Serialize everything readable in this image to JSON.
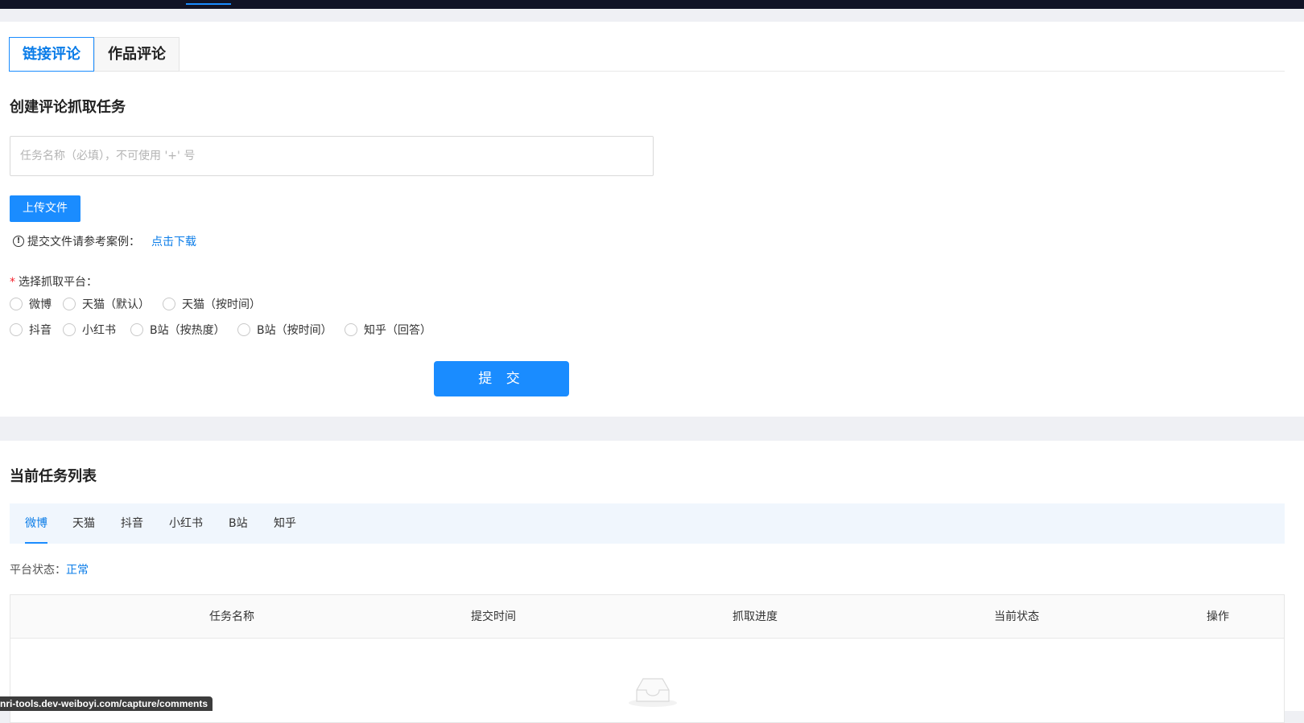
{
  "main_tabs": [
    "链接评论",
    "作品评论"
  ],
  "create": {
    "title": "创建评论抓取任务",
    "task_name_placeholder": "任务名称（必填），不可使用 '+' 号",
    "upload_label": "上传文件",
    "hint_text": "提交文件请参考案例：",
    "hint_link": "点击下载",
    "platform_label": "选择抓取平台：",
    "platform_required_mark": "*",
    "platforms_row1": [
      "微博",
      "天猫（默认）",
      "天猫（按时间）"
    ],
    "platforms_row2": [
      "抖音",
      "小红书",
      "B站（按热度）",
      "B站（按时间）",
      "知乎（回答）"
    ],
    "submit_label": "提 交"
  },
  "list": {
    "title": "当前任务列表",
    "tabs": [
      "微博",
      "天猫",
      "抖音",
      "小红书",
      "B站",
      "知乎"
    ],
    "active_tab": "微博",
    "status_label": "平台状态：",
    "status_value": "正常",
    "columns": [
      "任务名称",
      "提交时间",
      "抓取进度",
      "当前状态",
      "操作"
    ],
    "rows": []
  },
  "status_bar_url": "nri-tools.dev-weiboyi.com/capture/comments",
  "colors": {
    "accent": "#1a8cff",
    "link": "#0a7ce8",
    "topbar": "#111426"
  }
}
